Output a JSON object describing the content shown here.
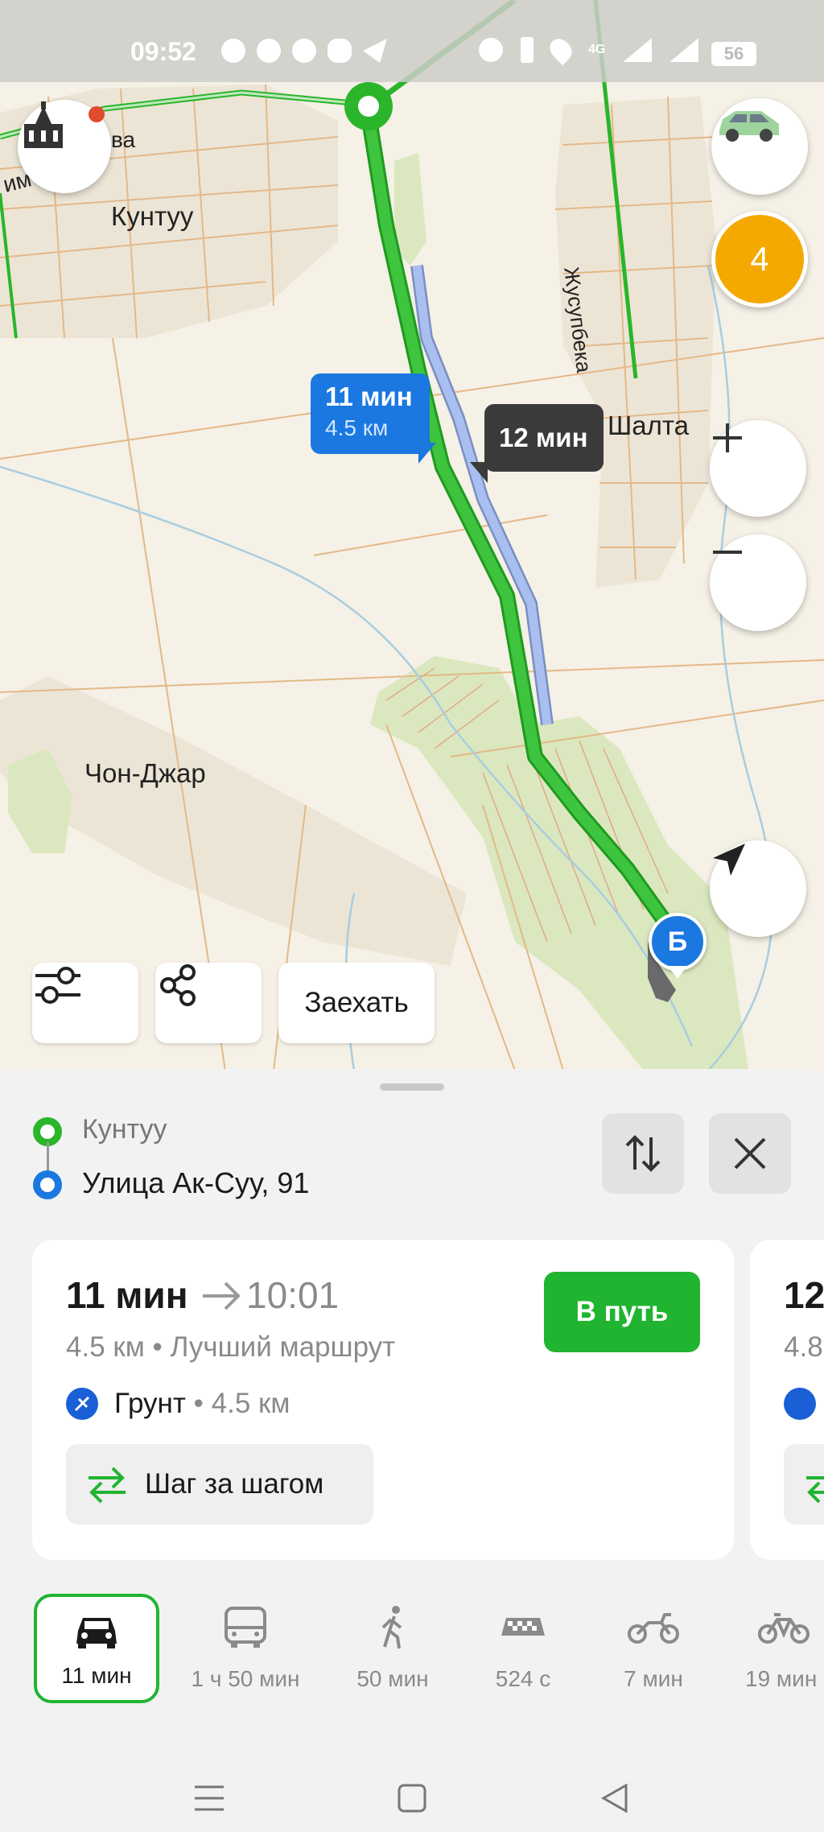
{
  "status_bar": {
    "time": "09:52",
    "network": "4G",
    "battery": "56"
  },
  "map": {
    "labels": {
      "kuntuu": "Кунтуу",
      "shalta": "Шалта",
      "chon_djar": "Чон-Джар",
      "jusupbeka": "Жусупбека",
      "street_partial": "ва",
      "street_partial_left": "им"
    },
    "route_bubble_primary": {
      "time": "11 мин",
      "distance": "4.5 км"
    },
    "route_bubble_alt": {
      "time": "12 мин"
    },
    "destination_marker": "Б",
    "notification_count": "4",
    "colors": {
      "route_green": "#2ab52a",
      "route_alt": "#a9bff0",
      "bubble_blue": "#1a78e0",
      "bubble_dark": "#3a3a3a",
      "badge_yellow": "#f4a900"
    }
  },
  "map_buttons": {
    "enter_label": "Заехать"
  },
  "route_panel": {
    "from": "Кунтуу",
    "to": "Улица Ак-Суу, 91"
  },
  "route_card": {
    "duration": "11 мин",
    "arrival": "10:01",
    "distance": "4.5 км",
    "separator": "•",
    "quality": "Лучший маршрут",
    "go_label": "В путь",
    "surface_type": "Грунт",
    "surface_distance": "4.5 км",
    "step_label": "Шаг за шагом"
  },
  "route_card_next": {
    "duration_partial": "12",
    "distance_partial": "4.8"
  },
  "transport_modes": [
    {
      "label": "11 мин",
      "icon": "car-icon",
      "selected": true
    },
    {
      "label": "1 ч 50 мин",
      "icon": "bus-icon",
      "selected": false
    },
    {
      "label": "50 мин",
      "icon": "walk-icon",
      "selected": false
    },
    {
      "label": "524 с",
      "icon": "taxi-icon",
      "selected": false
    },
    {
      "label": "7 мин",
      "icon": "motorcycle-icon",
      "selected": false
    },
    {
      "label": "19 мин",
      "icon": "bicycle-icon",
      "selected": false
    }
  ]
}
